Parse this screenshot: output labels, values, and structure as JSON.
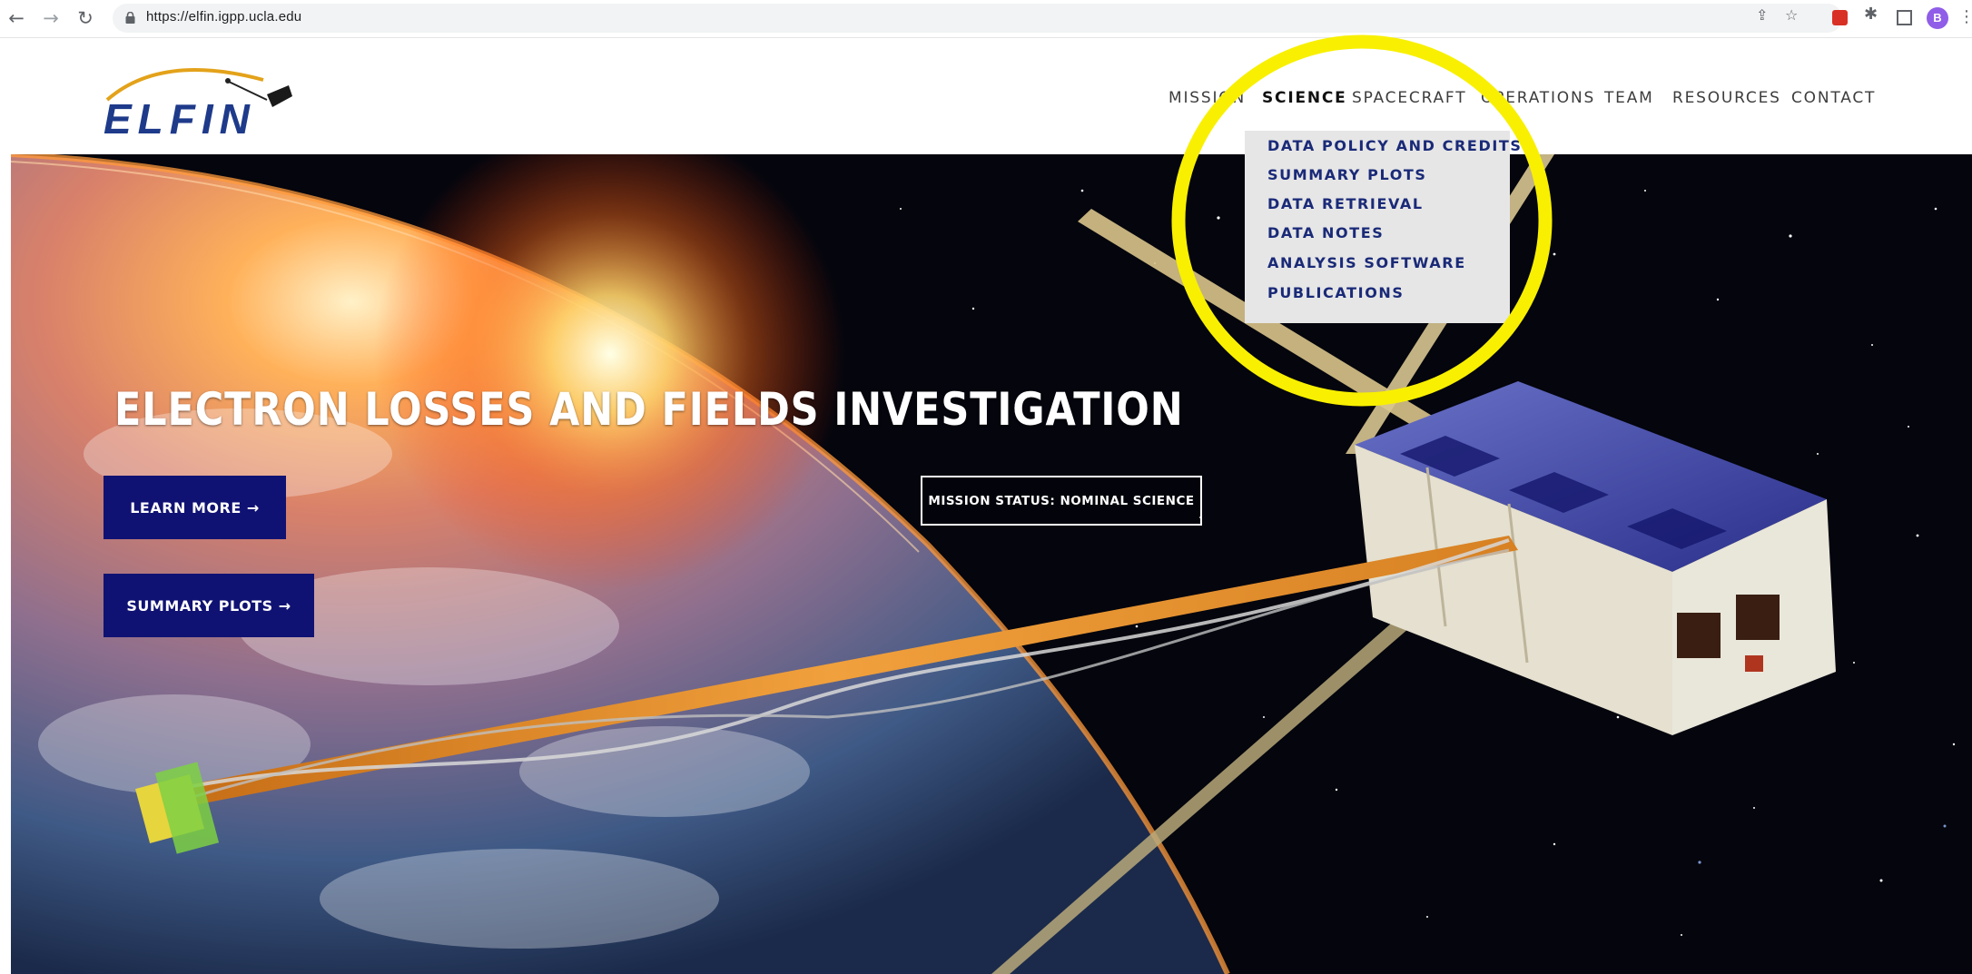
{
  "browser": {
    "url": "https://elfin.igpp.ucla.edu",
    "back_icon": "back-arrow-icon",
    "forward_icon": "forward-arrow-icon",
    "reload_icon": "reload-icon",
    "profile_initial": "B"
  },
  "logo": {
    "text": "ELFIN"
  },
  "nav": {
    "items": [
      {
        "label": "MISSION"
      },
      {
        "label": "SCIENCE"
      },
      {
        "label": "SPACECRAFT"
      },
      {
        "label": "OPERATIONS"
      },
      {
        "label": "TEAM"
      },
      {
        "label": "RESOURCES"
      },
      {
        "label": "CONTACT"
      }
    ],
    "active": "SCIENCE"
  },
  "dropdown": {
    "items": [
      {
        "label": "DATA POLICY AND CREDITS"
      },
      {
        "label": "SUMMARY PLOTS"
      },
      {
        "label": "DATA RETRIEVAL"
      },
      {
        "label": "DATA NOTES"
      },
      {
        "label": "ANALYSIS SOFTWARE"
      },
      {
        "label": "PUBLICATIONS"
      }
    ]
  },
  "hero": {
    "title": "ELECTRON LOSSES AND FIELDS INVESTIGATION",
    "learn_more": "LEARN MORE →",
    "summary_plots": "SUMMARY PLOTS →",
    "status": "MISSION STATUS: NOMINAL SCIENCE"
  },
  "colors": {
    "button_bg": "#101273",
    "dropdown_bg": "#e6e6e6",
    "dropdown_text": "#1a2a78",
    "highlight_ring": "#f8f000"
  }
}
